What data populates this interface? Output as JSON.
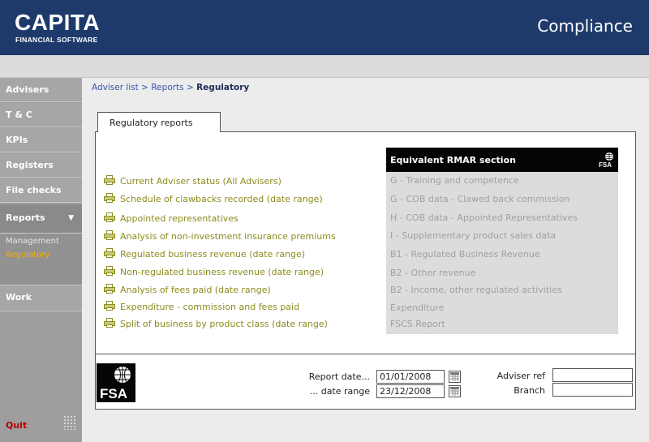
{
  "header": {
    "logo_text": "CAPITA",
    "logo_subtext": "FINANCIAL SOFTWARE",
    "app_title": "Compliance",
    "background_color": "#1d3a6b"
  },
  "sidebar": {
    "items": [
      {
        "label": "Advisers"
      },
      {
        "label": "T & C"
      },
      {
        "label": "KPIs"
      },
      {
        "label": "Registers"
      },
      {
        "label": "File checks"
      },
      {
        "label": "Reports"
      },
      {
        "label": "Work"
      }
    ],
    "reports_caret": "▼",
    "submenu": [
      {
        "label": "Management"
      },
      {
        "label": "Regulatory"
      }
    ],
    "quit_label": "Quit",
    "quit_color": "#b20000",
    "current_submenu_color": "#f2b100"
  },
  "breadcrumb": {
    "items": [
      "Adviser list",
      "Reports",
      "Regulatory"
    ],
    "separator": ">"
  },
  "tab": {
    "label": "Regulatory reports"
  },
  "reports": {
    "icon": "printer-icon",
    "items": [
      "Current Adviser status (All Advisers)",
      "Schedule of clawbacks recorded (date range)",
      "Appointed representatives",
      "Analysis of non-investment insurance premiums",
      "Regulated business revenue (date range)",
      "Non-regulated business revenue (date range)",
      "Analysis of fees paid (date range)",
      "Expenditure - commission and fees paid",
      "Split of business by product class (date range)"
    ],
    "link_color": "#8c8c1e"
  },
  "rmar": {
    "header": "Equivalent RMAR section",
    "logo_text": "FSA",
    "items": [
      "G - Training and competence",
      "G - COB data - Clawed back commission",
      "H - COB data - Appointed Representatives",
      "I - Supplementary product sales data",
      "B1 - Regulated Business Revenue",
      "B2 - Other revenue",
      "B2 - Income, other regulated activities",
      "Expenditure",
      "FSCS Report"
    ]
  },
  "footer": {
    "logo_text": "FSA",
    "report_date_label": "Report date...",
    "report_date_value": "01/01/2008",
    "date_range_label": "... date range",
    "date_range_value": "23/12/2008",
    "adviser_ref_label": "Adviser ref",
    "adviser_ref_value": "",
    "branch_label": "Branch",
    "branch_value": ""
  }
}
